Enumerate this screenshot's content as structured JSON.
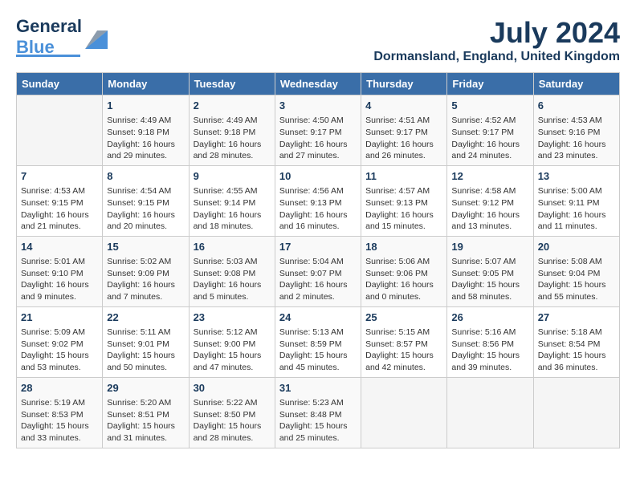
{
  "header": {
    "logo": {
      "part1": "General",
      "part2": "Blue"
    },
    "month_year": "July 2024",
    "location": "Dormansland, England, United Kingdom"
  },
  "days_of_week": [
    "Sunday",
    "Monday",
    "Tuesday",
    "Wednesday",
    "Thursday",
    "Friday",
    "Saturday"
  ],
  "weeks": [
    [
      {
        "day": "",
        "content": ""
      },
      {
        "day": "1",
        "content": "Sunrise: 4:49 AM\nSunset: 9:18 PM\nDaylight: 16 hours\nand 29 minutes."
      },
      {
        "day": "2",
        "content": "Sunrise: 4:49 AM\nSunset: 9:18 PM\nDaylight: 16 hours\nand 28 minutes."
      },
      {
        "day": "3",
        "content": "Sunrise: 4:50 AM\nSunset: 9:17 PM\nDaylight: 16 hours\nand 27 minutes."
      },
      {
        "day": "4",
        "content": "Sunrise: 4:51 AM\nSunset: 9:17 PM\nDaylight: 16 hours\nand 26 minutes."
      },
      {
        "day": "5",
        "content": "Sunrise: 4:52 AM\nSunset: 9:17 PM\nDaylight: 16 hours\nand 24 minutes."
      },
      {
        "day": "6",
        "content": "Sunrise: 4:53 AM\nSunset: 9:16 PM\nDaylight: 16 hours\nand 23 minutes."
      }
    ],
    [
      {
        "day": "7",
        "content": "Sunrise: 4:53 AM\nSunset: 9:15 PM\nDaylight: 16 hours\nand 21 minutes."
      },
      {
        "day": "8",
        "content": "Sunrise: 4:54 AM\nSunset: 9:15 PM\nDaylight: 16 hours\nand 20 minutes."
      },
      {
        "day": "9",
        "content": "Sunrise: 4:55 AM\nSunset: 9:14 PM\nDaylight: 16 hours\nand 18 minutes."
      },
      {
        "day": "10",
        "content": "Sunrise: 4:56 AM\nSunset: 9:13 PM\nDaylight: 16 hours\nand 16 minutes."
      },
      {
        "day": "11",
        "content": "Sunrise: 4:57 AM\nSunset: 9:13 PM\nDaylight: 16 hours\nand 15 minutes."
      },
      {
        "day": "12",
        "content": "Sunrise: 4:58 AM\nSunset: 9:12 PM\nDaylight: 16 hours\nand 13 minutes."
      },
      {
        "day": "13",
        "content": "Sunrise: 5:00 AM\nSunset: 9:11 PM\nDaylight: 16 hours\nand 11 minutes."
      }
    ],
    [
      {
        "day": "14",
        "content": "Sunrise: 5:01 AM\nSunset: 9:10 PM\nDaylight: 16 hours\nand 9 minutes."
      },
      {
        "day": "15",
        "content": "Sunrise: 5:02 AM\nSunset: 9:09 PM\nDaylight: 16 hours\nand 7 minutes."
      },
      {
        "day": "16",
        "content": "Sunrise: 5:03 AM\nSunset: 9:08 PM\nDaylight: 16 hours\nand 5 minutes."
      },
      {
        "day": "17",
        "content": "Sunrise: 5:04 AM\nSunset: 9:07 PM\nDaylight: 16 hours\nand 2 minutes."
      },
      {
        "day": "18",
        "content": "Sunrise: 5:06 AM\nSunset: 9:06 PM\nDaylight: 16 hours\nand 0 minutes."
      },
      {
        "day": "19",
        "content": "Sunrise: 5:07 AM\nSunset: 9:05 PM\nDaylight: 15 hours\nand 58 minutes."
      },
      {
        "day": "20",
        "content": "Sunrise: 5:08 AM\nSunset: 9:04 PM\nDaylight: 15 hours\nand 55 minutes."
      }
    ],
    [
      {
        "day": "21",
        "content": "Sunrise: 5:09 AM\nSunset: 9:02 PM\nDaylight: 15 hours\nand 53 minutes."
      },
      {
        "day": "22",
        "content": "Sunrise: 5:11 AM\nSunset: 9:01 PM\nDaylight: 15 hours\nand 50 minutes."
      },
      {
        "day": "23",
        "content": "Sunrise: 5:12 AM\nSunset: 9:00 PM\nDaylight: 15 hours\nand 47 minutes."
      },
      {
        "day": "24",
        "content": "Sunrise: 5:13 AM\nSunset: 8:59 PM\nDaylight: 15 hours\nand 45 minutes."
      },
      {
        "day": "25",
        "content": "Sunrise: 5:15 AM\nSunset: 8:57 PM\nDaylight: 15 hours\nand 42 minutes."
      },
      {
        "day": "26",
        "content": "Sunrise: 5:16 AM\nSunset: 8:56 PM\nDaylight: 15 hours\nand 39 minutes."
      },
      {
        "day": "27",
        "content": "Sunrise: 5:18 AM\nSunset: 8:54 PM\nDaylight: 15 hours\nand 36 minutes."
      }
    ],
    [
      {
        "day": "28",
        "content": "Sunrise: 5:19 AM\nSunset: 8:53 PM\nDaylight: 15 hours\nand 33 minutes."
      },
      {
        "day": "29",
        "content": "Sunrise: 5:20 AM\nSunset: 8:51 PM\nDaylight: 15 hours\nand 31 minutes."
      },
      {
        "day": "30",
        "content": "Sunrise: 5:22 AM\nSunset: 8:50 PM\nDaylight: 15 hours\nand 28 minutes."
      },
      {
        "day": "31",
        "content": "Sunrise: 5:23 AM\nSunset: 8:48 PM\nDaylight: 15 hours\nand 25 minutes."
      },
      {
        "day": "",
        "content": ""
      },
      {
        "day": "",
        "content": ""
      },
      {
        "day": "",
        "content": ""
      }
    ]
  ]
}
